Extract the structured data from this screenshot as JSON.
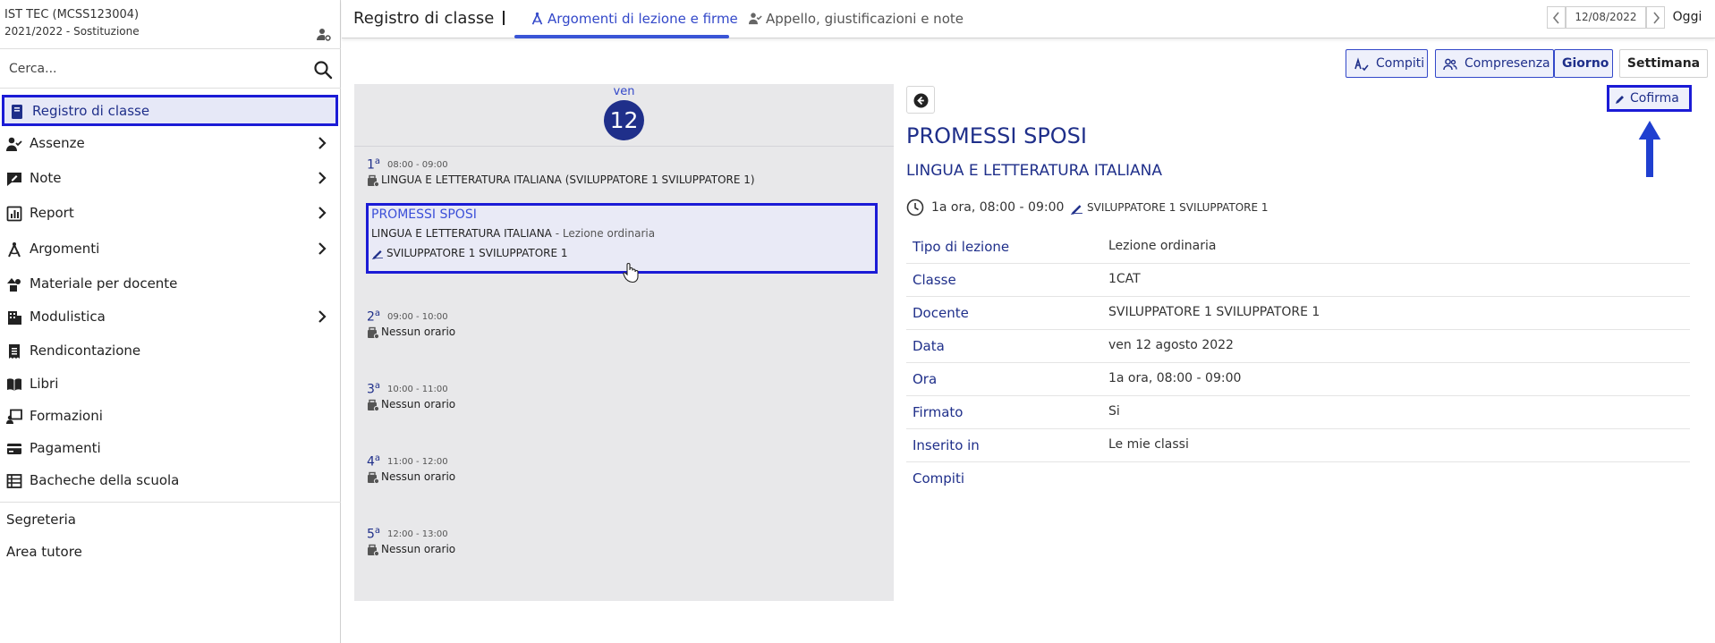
{
  "sidebar": {
    "school_name": "IST TEC (MCSS123004)",
    "school_year": "2021/2022 - Sostituzione",
    "search_placeholder": "Cerca...",
    "items": [
      {
        "label": "Registro di classe"
      },
      {
        "label": "Assenze"
      },
      {
        "label": "Note"
      },
      {
        "label": "Report"
      },
      {
        "label": "Argomenti"
      },
      {
        "label": "Materiale per docente"
      },
      {
        "label": "Modulistica"
      },
      {
        "label": "Rendicontazione"
      },
      {
        "label": "Libri"
      },
      {
        "label": "Formazioni"
      },
      {
        "label": "Pagamenti"
      },
      {
        "label": "Bacheche della scuola"
      }
    ],
    "extra": [
      "Segreteria",
      "Area tutore"
    ]
  },
  "topbar": {
    "title": "Registro di classe",
    "tabs": [
      {
        "label": "Argomenti di lezione e firme"
      },
      {
        "label": "Appello, giustificazioni e note"
      }
    ],
    "date": "12/08/2022",
    "today_label": "Oggi"
  },
  "actions": {
    "compiti": "Compiti",
    "comprese": "Compresenza",
    "giorno": "Giorno",
    "settimana": "Settimana",
    "cofirma": "Cofirma"
  },
  "day": {
    "weekday": "ven",
    "number": "12",
    "slots": [
      {
        "hour": "1",
        "sup": "a",
        "time": "08:00 - 09:00",
        "text": "LINGUA E LETTERATURA ITALIANA (SVILUPPATORE 1 SVILUPPATORE 1)"
      },
      {
        "hour": "2",
        "sup": "a",
        "time": "09:00 - 10:00",
        "text": "Nessun orario"
      },
      {
        "hour": "3",
        "sup": "a",
        "time": "10:00 - 11:00",
        "text": "Nessun orario"
      },
      {
        "hour": "4",
        "sup": "a",
        "time": "11:00 - 12:00",
        "text": "Nessun orario"
      },
      {
        "hour": "5",
        "sup": "a",
        "time": "12:00 - 13:00",
        "text": "Nessun orario"
      }
    ],
    "lesson": {
      "title": "PROMESSI SPOSI",
      "subject": "LINGUA E LETTERATURA ITALIANA",
      "type": " - Lezione ordinaria",
      "teacher": "SVILUPPATORE 1 SVILUPPATORE 1"
    }
  },
  "detail": {
    "title": "PROMESSI SPOSI",
    "subject": "LINGUA E LETTERATURA ITALIANA",
    "time": "1a ora, 08:00 - 09:00",
    "teacher": "SVILUPPATORE 1 SVILUPPATORE 1",
    "rows": [
      {
        "key": "Tipo di lezione",
        "value": "Lezione ordinaria"
      },
      {
        "key": "Classe",
        "value": "1CAT"
      },
      {
        "key": "Docente",
        "value": "SVILUPPATORE 1 SVILUPPATORE 1"
      },
      {
        "key": "Data",
        "value": "ven 12 agosto 2022"
      },
      {
        "key": "Ora",
        "value": "1a ora, 08:00 - 09:00"
      },
      {
        "key": "Firmato",
        "value": "Si"
      },
      {
        "key": "Inserito in",
        "value": "Le mie classi"
      },
      {
        "key": "Compiti",
        "value": ""
      }
    ]
  },
  "colors": {
    "primary": "#1f2f8a",
    "accent": "#3348c9",
    "highlight": "#1b1bd6",
    "panel_bg": "#e8e8ea"
  }
}
